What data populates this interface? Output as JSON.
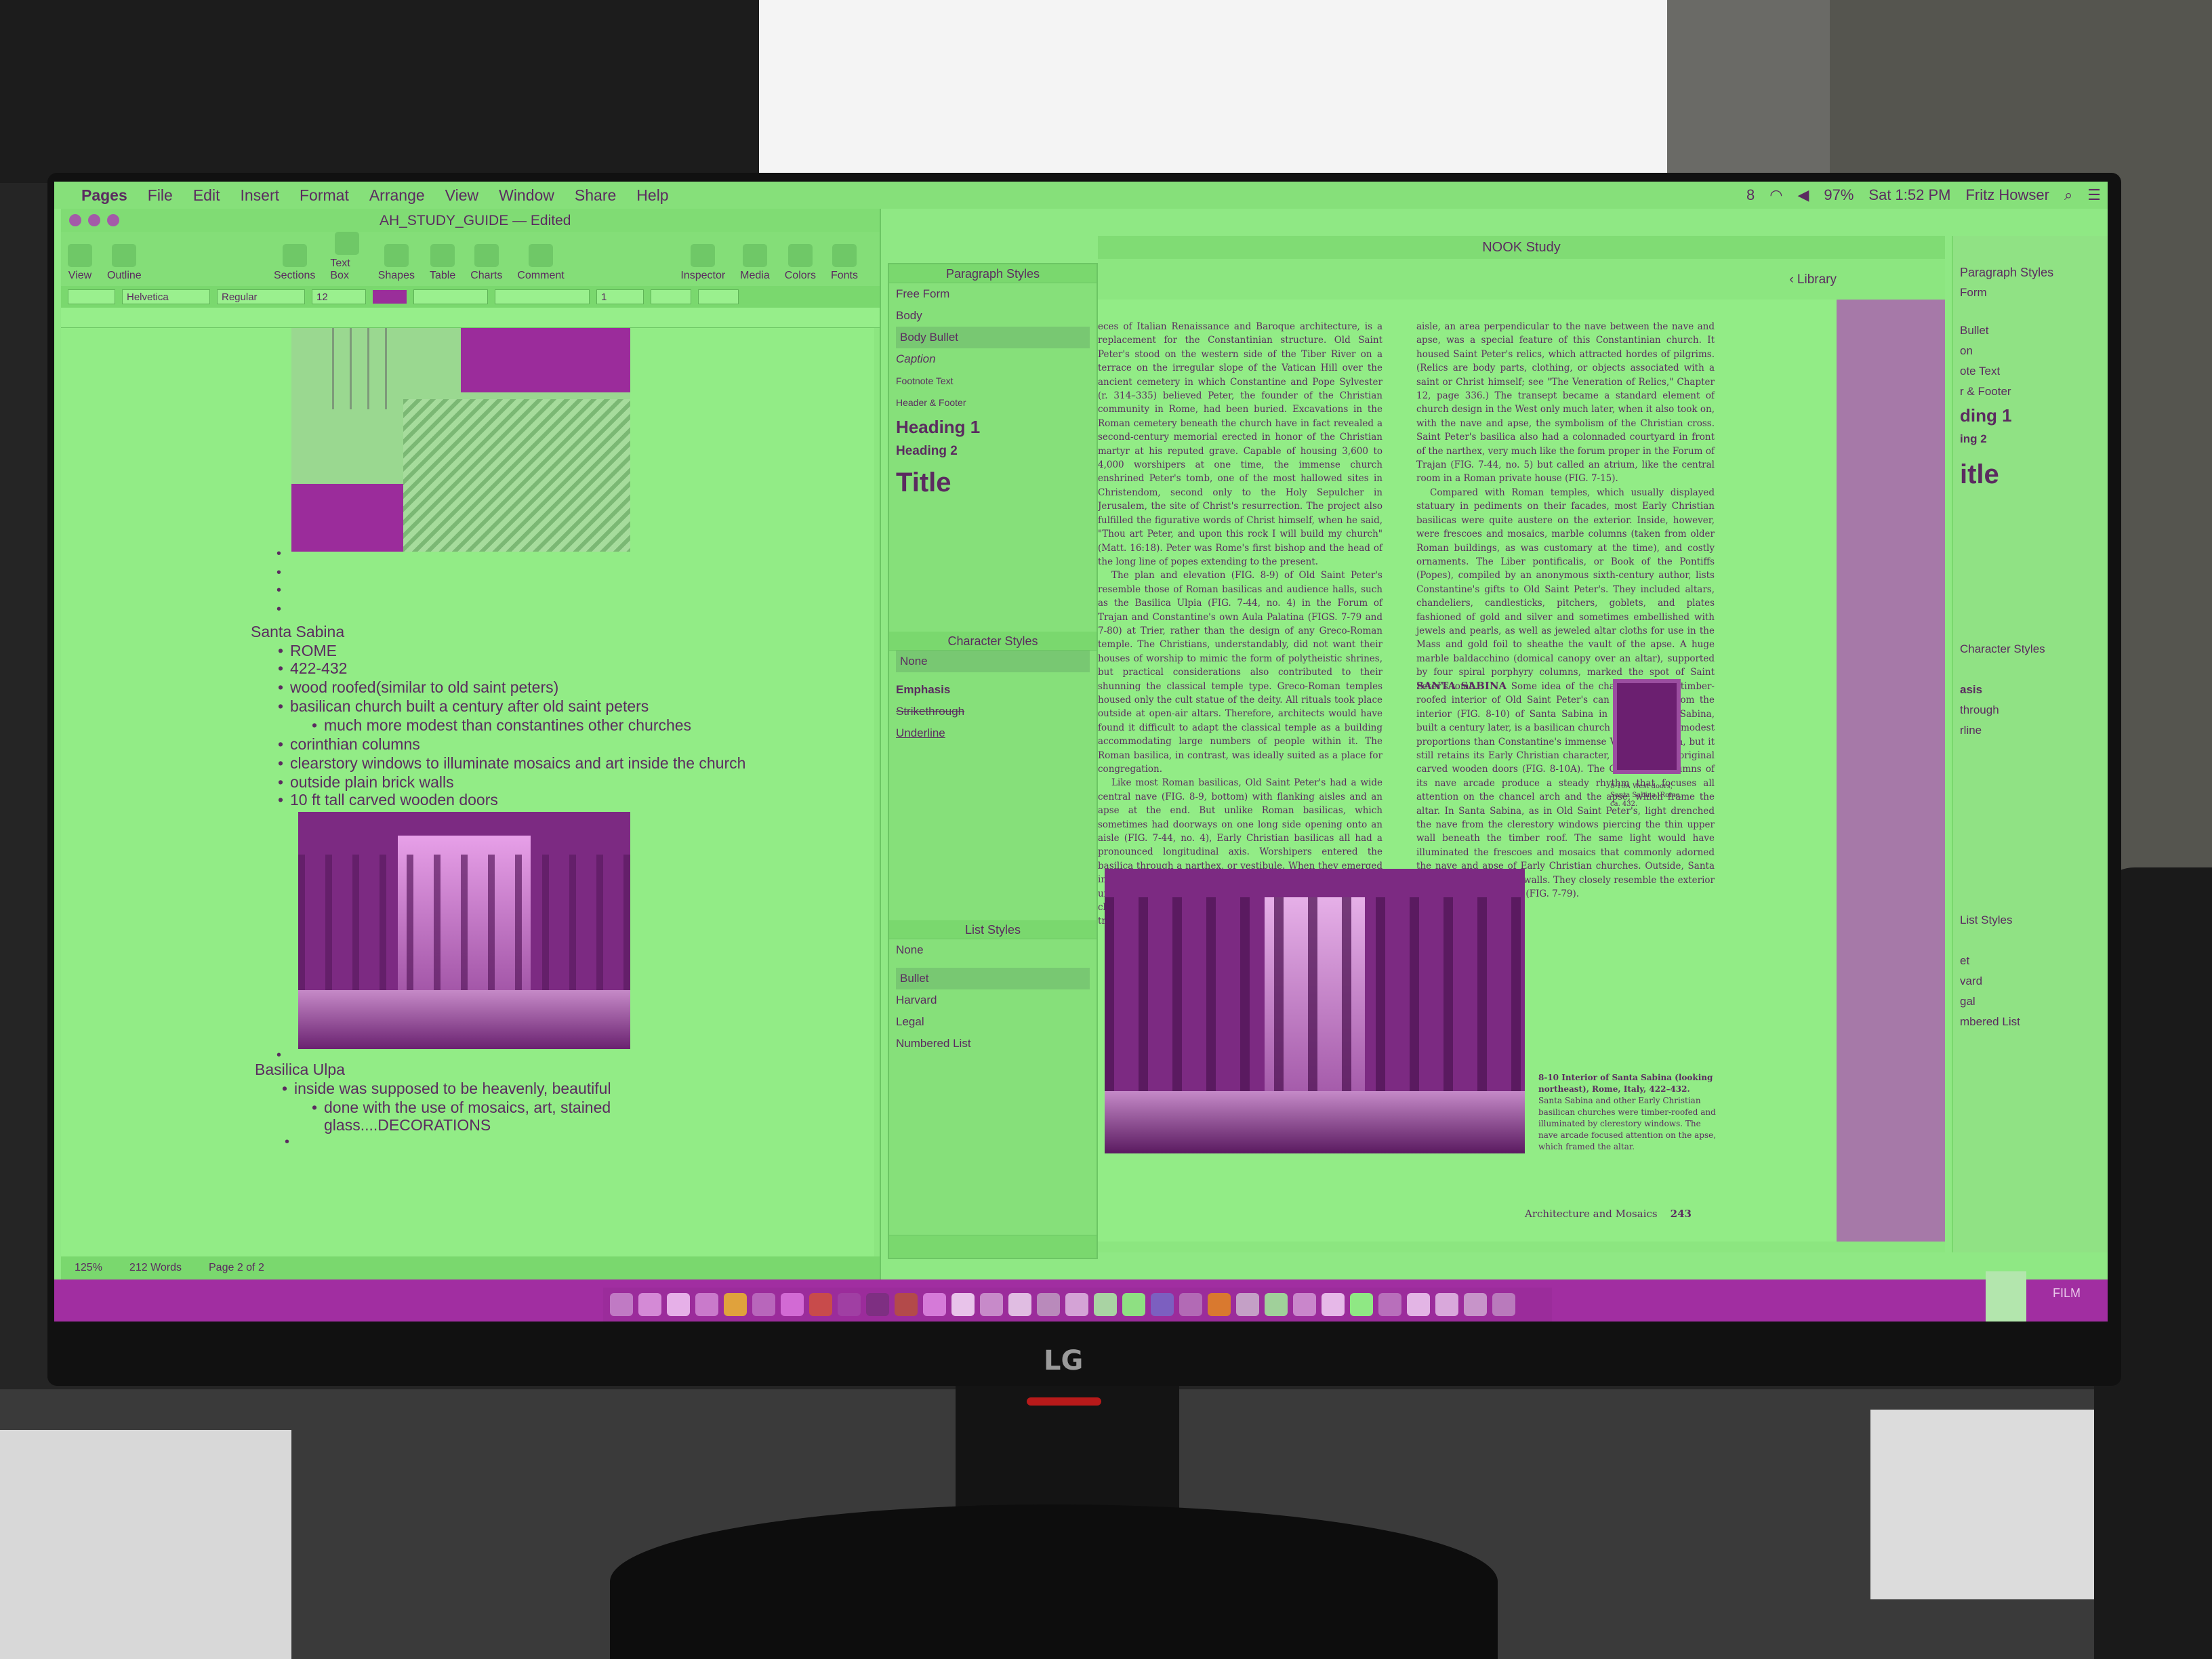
{
  "menubar": {
    "app": "Pages",
    "items": [
      "File",
      "Edit",
      "Insert",
      "Format",
      "Arrange",
      "View",
      "Window",
      "Share",
      "Help"
    ],
    "status_icons": [
      "8",
      "97%"
    ],
    "clock": "Sat 1:52 PM",
    "user": "Fritz Howser"
  },
  "pages": {
    "title": "AH_STUDY_GUIDE",
    "title_suffix": "— Edited",
    "toolbar": [
      "View",
      "Outline",
      "Sections",
      "Text Box",
      "Shapes",
      "Table",
      "Charts",
      "Comment",
      "Inspector",
      "Media",
      "Colors",
      "Fonts"
    ],
    "format": {
      "font": "Helvetica",
      "style": "Regular",
      "size": "12",
      "spacing": "1"
    },
    "notes": {
      "heading1": "Santa Sabina",
      "items1": [
        "ROME",
        "422-432",
        "wood roofed(similar to old saint peters)",
        "basilican church built a century after old saint peters"
      ],
      "sub1": "much more modest than constantines other churches",
      "items1b": [
        "corinthian columns",
        "clearstory windows to illuminate mosaics and art inside the church",
        "outside plain brick walls",
        "10 ft tall carved wooden doors"
      ],
      "heading2": "Basilica Ulpa",
      "items2": [
        "inside was supposed to be heavenly, beautiful"
      ],
      "sub2": "done with the use of mosaics, art, stained",
      "sub2b": "glass....DECORATIONS"
    },
    "status": {
      "zoom": "125%",
      "words": "212 Words",
      "page": "Page 2 of 2"
    }
  },
  "styles_panel": {
    "paragraph_header": "Paragraph Styles",
    "paragraph": [
      "Free Form",
      "Body",
      "Body Bullet",
      "Caption",
      "Footnote Text",
      "Header & Footer",
      "Heading 1",
      "Heading 2",
      "Title"
    ],
    "character_header": "Character Styles",
    "character_selected": "None",
    "character": [
      "Emphasis",
      "Strikethrough",
      "Underline"
    ],
    "list_header": "List Styles",
    "list_none": "None",
    "list": [
      "Bullet",
      "Harvard",
      "Legal",
      "Numbered List"
    ]
  },
  "nook": {
    "title": "NOOK Study",
    "library": "‹ Library",
    "col1": [
      "eces of Italian Renaissance and Baroque architecture, is a replacement for the Constantinian structure. Old Saint Peter's stood on the western side of the Tiber River on a terrace on the irregular slope of the Vatican Hill over the ancient cemetery in which Constantine and Pope Sylvester (r. 314–335) believed Peter, the founder of the Christian community in Rome, had been buried. Excavations in the Roman cemetery beneath the church have in fact revealed a second-century memorial erected in honor of the Christian martyr at his reputed grave. Capable of housing 3,600 to 4,000 worshipers at one time, the immense church enshrined Peter's tomb, one of the most hallowed sites in Christendom, second only to the Holy Sepulcher in Jerusalem, the site of Christ's resurrection. The project also fulfilled the figurative words of Christ himself, when he said, \"Thou art Peter, and upon this rock I will build my church\" (Matt. 16:18). Peter was Rome's first bishop and the head of the long line of popes extending to the present.",
      "The plan and elevation (FIG. 8-9) of Old Saint Peter's resemble those of Roman basilicas and audience halls, such as the Basilica Ulpia (FIG. 7-44, no. 4) in the Forum of Trajan and Constantine's own Aula Palatina (FIGS. 7-79 and 7-80) at Trier, rather than the design of any Greco-Roman temple. The Christians, understandably, did not want their houses of worship to mimic the form of polytheistic shrines, but practical considerations also contributed to their shunning the classical temple type. Greco-Roman temples housed only the cult statue of the deity. All rituals took place outside at open-air altars. Therefore, architects would have found it difficult to adapt the classical temple as a building accommodating large numbers of people within it. The Roman basilica, in contrast, was ideally suited as a place for congregation.",
      "Like most Roman basilicas, Old Saint Peter's had a wide central nave (FIG. 8-9, bottom) with flanking aisles and an apse at the end. But unlike Roman basilicas, which sometimes had doorways on one long side opening onto an aisle (FIG. 7-44, no. 4), Early Christian basilicas all had a pronounced longitudinal axis. Worshipers entered the basilica through a narthex, or vestibule. When they emerged in Saint Peter's 300-foot-long nave, they had an unobstructed view of the altar in the apse, framed by the chancel arch dividing the nave from the transept. The transept, or transverse"
    ],
    "col2": [
      "aisle, an area perpendicular to the nave between the nave and apse, was a special feature of this Constantinian church. It housed Saint Peter's relics, which attracted hordes of pilgrims. (Relics are body parts, clothing, or objects associated with a saint or Christ himself; see \"The Veneration of Relics,\" Chapter 12, page 336.) The transept became a standard element of church design in the West only much later, when it also took on, with the nave and apse, the symbolism of the Christian cross. Saint Peter's basilica also had a colonnaded courtyard in front of the narthex, very much like the forum proper in the Forum of Trajan (FIG. 7-44, no. 5) but called an atrium, like the central room in a Roman private house (FIG. 7-15).",
      "Compared with Roman temples, which usually displayed statuary in pediments on their facades, most Early Christian basilicas were quite austere on the exterior. Inside, however, were frescoes and mosaics, marble columns (taken from older Roman buildings, as was customary at the time), and costly ornaments. The Liber pontificalis, or Book of the Pontiffs (Popes), compiled by an anonymous sixth-century author, lists Constantine's gifts to Old Saint Peter's. They included altars, chandeliers, candlesticks, pitchers, goblets, and plates fashioned of gold and silver and sometimes embellished with jewels and pearls, as well as jeweled altar cloths for use in the Mass and gold foil to sheathe the vault of the apse. A huge marble baldacchino (domical canopy over an altar), supported by four spiral porphyry columns, marked the spot of Saint Peter's tomb."
    ],
    "section_head": "SANTA SABINA",
    "section_text": "Some idea of the character of the timber-roofed interior of Old Saint Peter's can be gleaned from the interior (FIG. 8-10) of Santa Sabina in Rome. Santa Sabina, built a century later, is a basilican church of much more modest proportions than Constantine's immense Vatican basilica, but it still retains its Early Christian character, as well as its original carved wooden doors (FIG. 8-10A). The Corinthian columns of its nave arcade produce a steady rhythm that focuses all attention on the chancel arch and the apse, which frame the altar. In Santa Sabina, as in Old Saint Peter's, light drenched the nave from the clerestory windows piercing the thin upper wall beneath the timber roof. The same light would have illuminated the frescoes and mosaics that commonly adorned the nave and apse of Early Christian churches. Outside, Santa Sabina has plain brick walls. They closely resemble the exterior of Trier's Aula Palatina (FIG. 7-79).",
    "door_caption": "8-10A West doors, Santa Sabina, Rome, ca. 432.",
    "fig_caption_title": "8-10 Interior of Santa Sabina (looking northeast), Rome, Italy, 422–432.",
    "fig_caption_text": "Santa Sabina and other Early Christian basilican churches were timber-roofed and illuminated by clerestory windows. The nave arcade focused attention on the apse, which framed the altar.",
    "footer_title": "Architecture and Mosaics",
    "footer_page": "243"
  },
  "ghost": {
    "header": "Paragraph Styles",
    "items": [
      "Form",
      "Bullet",
      "on",
      "ote Text",
      "r & Footer",
      "ding 1",
      "ing 2",
      "itle",
      "Character Styles",
      "asis",
      "through",
      "rline",
      "List Styles",
      "et",
      "vard",
      "gal",
      "mbered List"
    ]
  },
  "desktop": {
    "film_label": "FILM"
  },
  "hardware": {
    "brand": "LG"
  }
}
